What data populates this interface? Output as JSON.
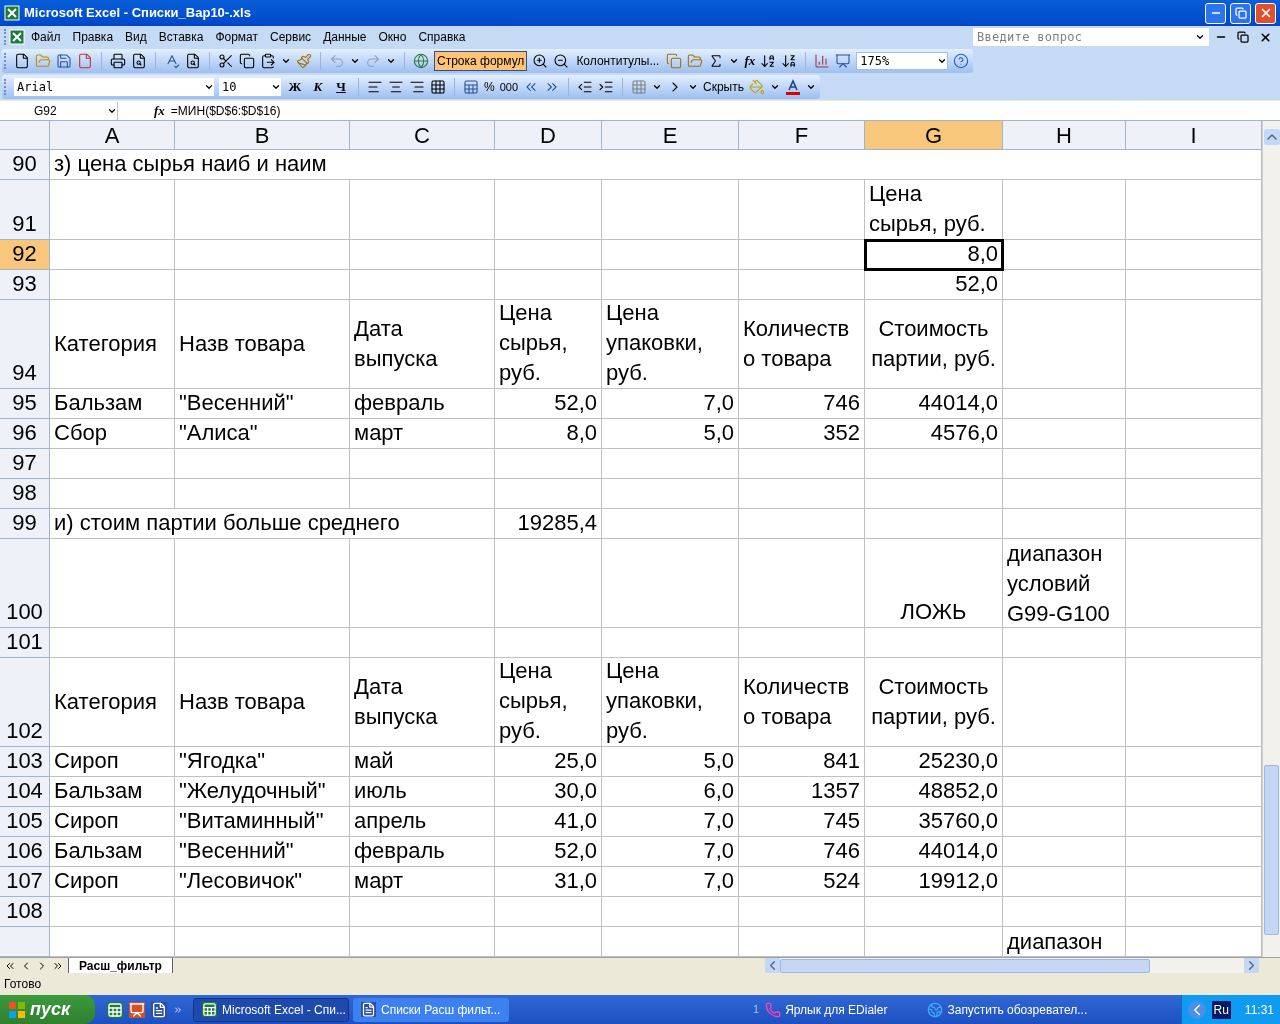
{
  "window": {
    "title": "Microsoft Excel - Списки_Вар10-.xls"
  },
  "menu": [
    "Файл",
    "Правка",
    "Вид",
    "Вставка",
    "Формат",
    "Сервис",
    "Данные",
    "Окно",
    "Справка"
  ],
  "help_search": {
    "placeholder": "Введите вопрос"
  },
  "standard_toolbar": {
    "formula_bar_button": {
      "label": "Строка формул",
      "on": true
    },
    "headers_footers_button": "Колонтитулы...",
    "function_button": "fx",
    "zoom": "175%"
  },
  "formatting_toolbar": {
    "font": "Arial",
    "font_size": "10",
    "bold": "Ж",
    "italic": "К",
    "underline": "Ч",
    "percent": "%",
    "thousands": "000",
    "hide_button": "Скрыть"
  },
  "formula_bar": {
    "name_box": "G92",
    "function_label": "fx",
    "formula": "=МИН($D$6:$D$16)"
  },
  "columns": [
    {
      "label": "A",
      "selected": false
    },
    {
      "label": "B",
      "selected": false
    },
    {
      "label": "C",
      "selected": false
    },
    {
      "label": "D",
      "selected": false
    },
    {
      "label": "E",
      "selected": false
    },
    {
      "label": "F",
      "selected": false
    },
    {
      "label": "G",
      "selected": true
    },
    {
      "label": "H",
      "selected": false
    },
    {
      "label": "I",
      "selected": false
    }
  ],
  "rows": [
    {
      "num": "90",
      "selected": false,
      "cells": {
        "A": {
          "kind": "text",
          "text": "з) цена сырья наиб и наим"
        }
      }
    },
    {
      "num": "91",
      "selected": false,
      "cells": {
        "G": {
          "kind": "stacked",
          "lines": [
            "Цена",
            "сырья, руб."
          ]
        }
      }
    },
    {
      "num": "92",
      "selected": true,
      "cells": {
        "G": {
          "kind": "number",
          "text": "8,0"
        }
      }
    },
    {
      "num": "93",
      "selected": false,
      "cells": {
        "G": {
          "kind": "number",
          "text": "52,0"
        }
      }
    },
    {
      "num": "94",
      "selected": false,
      "cells": {
        "A": {
          "kind": "heading",
          "lines": [
            "Категория"
          ]
        },
        "B": {
          "kind": "heading",
          "lines": [
            "Назв товара"
          ]
        },
        "C": {
          "kind": "heading",
          "lines": [
            "Дата",
            "выпуска"
          ]
        },
        "D": {
          "kind": "stacked",
          "lines": [
            "Цена",
            "сырья,",
            "руб."
          ]
        },
        "E": {
          "kind": "stacked",
          "lines": [
            "Цена",
            "упаковки,",
            "руб."
          ]
        },
        "F": {
          "kind": "heading",
          "lines": [
            "Количеств",
            "о товара"
          ]
        },
        "G": {
          "kind": "centered",
          "lines": [
            "Стоимость",
            "партии, руб."
          ]
        }
      }
    },
    {
      "num": "95",
      "selected": false,
      "cells": {
        "A": {
          "kind": "text",
          "text": "Бальзам"
        },
        "B": {
          "kind": "text",
          "text": "\"Весенний\""
        },
        "C": {
          "kind": "text",
          "text": "февраль"
        },
        "D": {
          "kind": "number",
          "text": "52,0"
        },
        "E": {
          "kind": "number",
          "text": "7,0"
        },
        "F": {
          "kind": "number",
          "text": "746"
        },
        "G": {
          "kind": "number",
          "text": "44014,0"
        }
      }
    },
    {
      "num": "96",
      "selected": false,
      "cells": {
        "A": {
          "kind": "text",
          "text": "Сбор"
        },
        "B": {
          "kind": "text",
          "text": "\"Алиса\""
        },
        "C": {
          "kind": "text",
          "text": "март"
        },
        "D": {
          "kind": "number",
          "text": "8,0"
        },
        "E": {
          "kind": "number",
          "text": "5,0"
        },
        "F": {
          "kind": "number",
          "text": "352"
        },
        "G": {
          "kind": "number",
          "text": "4576,0"
        }
      }
    },
    {
      "num": "97",
      "selected": false,
      "cells": {}
    },
    {
      "num": "98",
      "selected": false,
      "cells": {}
    },
    {
      "num": "99",
      "selected": false,
      "cells": {
        "A": {
          "kind": "text",
          "text": "и) стоим  партии больше среднего"
        },
        "D": {
          "kind": "number",
          "text": "19285,4"
        }
      }
    },
    {
      "num": "100",
      "selected": false,
      "cells": {
        "G": {
          "kind": "boolean",
          "text": "ЛОЖЬ"
        },
        "H": {
          "kind": "note",
          "lines": [
            "диапазон",
            "условий",
            "G99-G100"
          ]
        }
      }
    },
    {
      "num": "101",
      "selected": false,
      "cells": {}
    },
    {
      "num": "102",
      "selected": false,
      "cells": {
        "A": {
          "kind": "heading",
          "lines": [
            "Категория"
          ]
        },
        "B": {
          "kind": "heading",
          "lines": [
            "Назв товара"
          ]
        },
        "C": {
          "kind": "heading",
          "lines": [
            "Дата",
            "выпуска"
          ]
        },
        "D": {
          "kind": "stacked",
          "lines": [
            "Цена",
            "сырья,",
            "руб."
          ]
        },
        "E": {
          "kind": "stacked",
          "lines": [
            "Цена",
            "упаковки,",
            "руб."
          ]
        },
        "F": {
          "kind": "heading",
          "lines": [
            "Количеств",
            "о товара"
          ]
        },
        "G": {
          "kind": "centered",
          "lines": [
            "Стоимость",
            "партии, руб."
          ]
        }
      }
    },
    {
      "num": "103",
      "selected": false,
      "cells": {
        "A": {
          "kind": "text",
          "text": "Сироп"
        },
        "B": {
          "kind": "text",
          "text": "\"Ягодка\""
        },
        "C": {
          "kind": "text",
          "text": "май"
        },
        "D": {
          "kind": "number",
          "text": "25,0"
        },
        "E": {
          "kind": "number",
          "text": "5,0"
        },
        "F": {
          "kind": "number",
          "text": "841"
        },
        "G": {
          "kind": "number",
          "text": "25230,0"
        }
      }
    },
    {
      "num": "104",
      "selected": false,
      "cells": {
        "A": {
          "kind": "text",
          "text": "Бальзам"
        },
        "B": {
          "kind": "text",
          "text": "\"Желудочный\""
        },
        "C": {
          "kind": "text",
          "text": "июль"
        },
        "D": {
          "kind": "number",
          "text": "30,0"
        },
        "E": {
          "kind": "number",
          "text": "6,0"
        },
        "F": {
          "kind": "number",
          "text": "1357"
        },
        "G": {
          "kind": "number",
          "text": "48852,0"
        }
      }
    },
    {
      "num": "105",
      "selected": false,
      "cells": {
        "A": {
          "kind": "text",
          "text": "Сироп"
        },
        "B": {
          "kind": "text",
          "text": "\"Витаминный\""
        },
        "C": {
          "kind": "text",
          "text": "апрель"
        },
        "D": {
          "kind": "number",
          "text": "41,0"
        },
        "E": {
          "kind": "number",
          "text": "7,0"
        },
        "F": {
          "kind": "number",
          "text": "745"
        },
        "G": {
          "kind": "number",
          "text": "35760,0"
        }
      }
    },
    {
      "num": "106",
      "selected": false,
      "cells": {
        "A": {
          "kind": "text",
          "text": "Бальзам"
        },
        "B": {
          "kind": "text",
          "text": "\"Весенний\""
        },
        "C": {
          "kind": "text",
          "text": "февраль"
        },
        "D": {
          "kind": "number",
          "text": "52,0"
        },
        "E": {
          "kind": "number",
          "text": "7,0"
        },
        "F": {
          "kind": "number",
          "text": "746"
        },
        "G": {
          "kind": "number",
          "text": "44014,0"
        }
      }
    },
    {
      "num": "107",
      "selected": false,
      "cells": {
        "A": {
          "kind": "text",
          "text": "Сироп"
        },
        "B": {
          "kind": "text",
          "text": "\"Лесовичок\""
        },
        "C": {
          "kind": "text",
          "text": "март"
        },
        "D": {
          "kind": "number",
          "text": "31,0"
        },
        "E": {
          "kind": "number",
          "text": "7,0"
        },
        "F": {
          "kind": "number",
          "text": "524"
        },
        "G": {
          "kind": "number",
          "text": "19912,0"
        }
      }
    },
    {
      "num": "108",
      "selected": false,
      "cells": {}
    },
    {
      "selected": false,
      "cells": {
        "H": {
          "kind": "note",
          "lines": [
            "диапазон"
          ]
        }
      }
    }
  ],
  "sheet_tabs": [
    {
      "label": "Расш_фильтр",
      "selected": true
    }
  ],
  "status_bar": "Готово",
  "taskbar": {
    "start": "пуск",
    "tasks": [
      {
        "label": "Microsoft Excel - Спи...",
        "selected": true,
        "kind": "excel"
      },
      {
        "label": "Списки Расш фильт...",
        "selected": false,
        "kind": "word"
      }
    ],
    "toolbar_count": "1",
    "shortcuts": [
      {
        "label": "Ярлык для EDialer",
        "kind": "phone"
      },
      {
        "label": "Запустить обозревател...",
        "kind": "browser"
      }
    ],
    "language": "Ru",
    "clock": "11:31"
  }
}
